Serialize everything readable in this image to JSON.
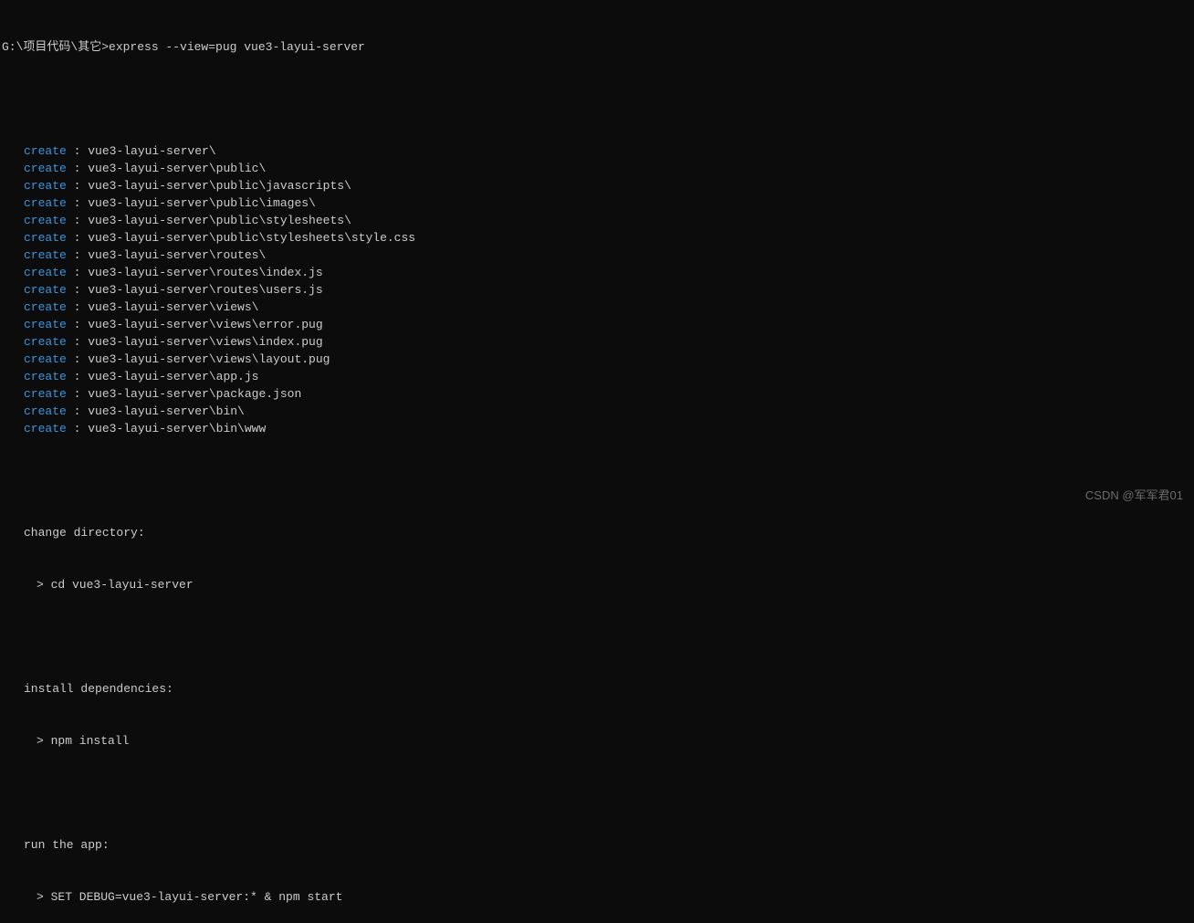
{
  "prompt": {
    "path": "G:\\项目代码\\其它>",
    "command": "express --view=pug vue3-layui-server"
  },
  "created": [
    "vue3-layui-server\\",
    "vue3-layui-server\\public\\",
    "vue3-layui-server\\public\\javascripts\\",
    "vue3-layui-server\\public\\images\\",
    "vue3-layui-server\\public\\stylesheets\\",
    "vue3-layui-server\\public\\stylesheets\\style.css",
    "vue3-layui-server\\routes\\",
    "vue3-layui-server\\routes\\index.js",
    "vue3-layui-server\\routes\\users.js",
    "vue3-layui-server\\views\\",
    "vue3-layui-server\\views\\error.pug",
    "vue3-layui-server\\views\\index.pug",
    "vue3-layui-server\\views\\layout.pug",
    "vue3-layui-server\\app.js",
    "vue3-layui-server\\package.json",
    "vue3-layui-server\\bin\\",
    "vue3-layui-server\\bin\\www"
  ],
  "createKeyword": "create",
  "instructions": {
    "changeDir": {
      "label": "change directory:",
      "command": "> cd vue3-layui-server"
    },
    "installDeps": {
      "label": "install dependencies:",
      "command": "> npm install"
    },
    "runApp": {
      "label": "run the app:",
      "command": "> SET DEBUG=vue3-layui-server:* & npm start"
    }
  },
  "watermark": "CSDN @军军君01"
}
